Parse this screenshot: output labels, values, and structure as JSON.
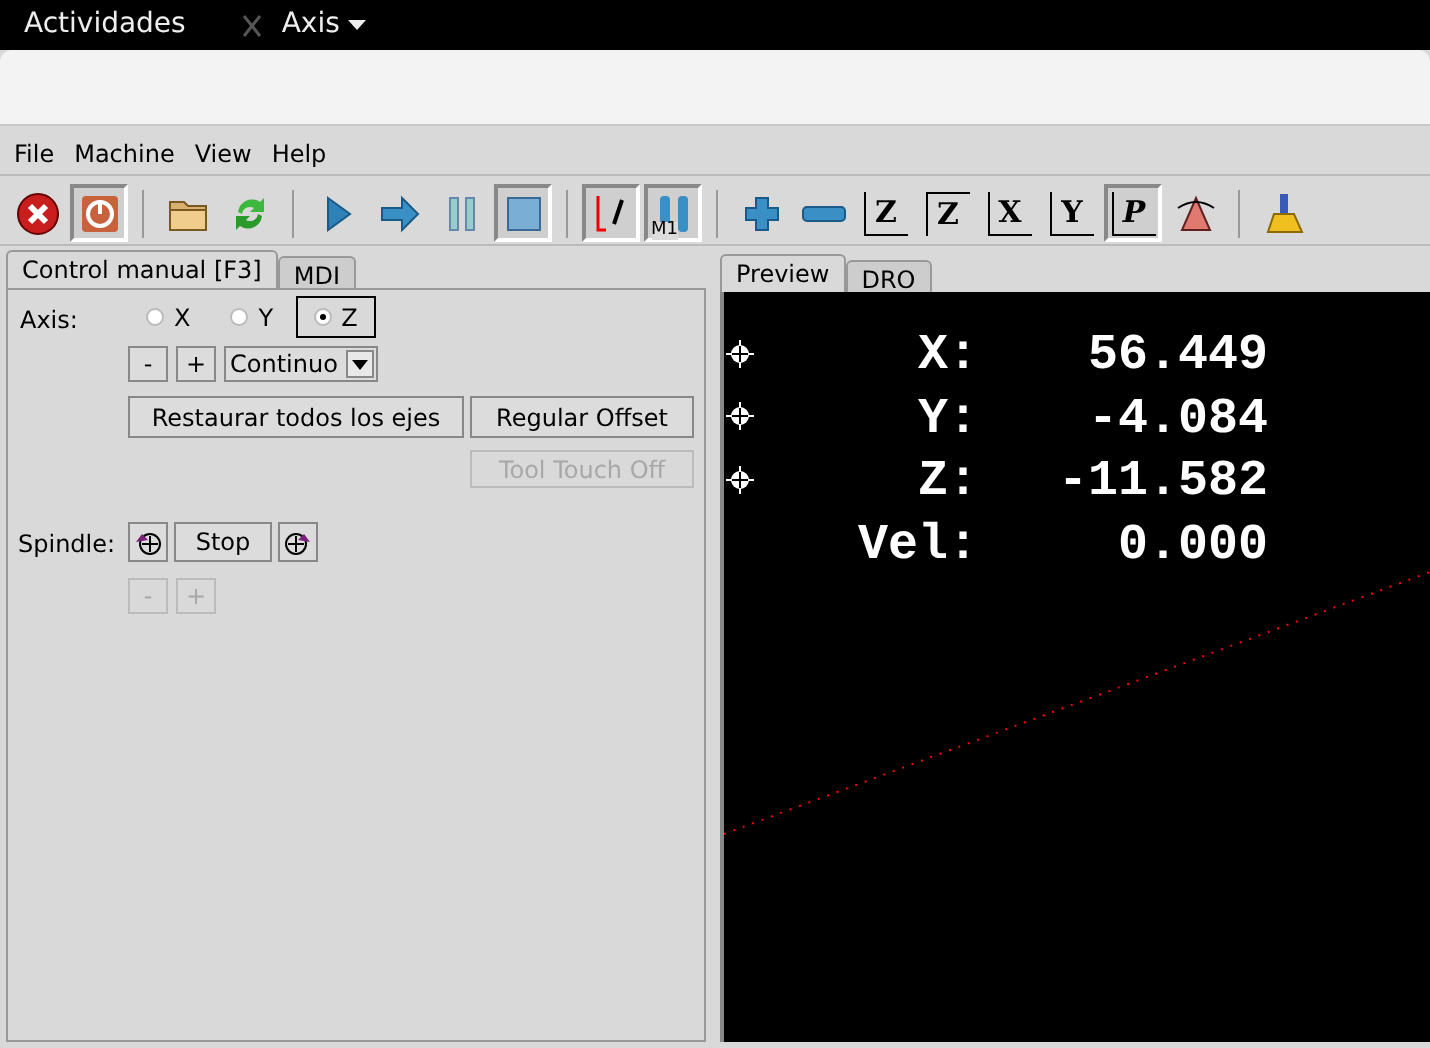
{
  "top_bar": {
    "activities": "Actividades",
    "app_menu": "Axis"
  },
  "menu": [
    "File",
    "Machine",
    "View",
    "Help"
  ],
  "toolbar": [
    {
      "kind": "estop",
      "pressed": false
    },
    {
      "kind": "power",
      "pressed": true
    },
    {
      "kind": "separator"
    },
    {
      "kind": "open",
      "pressed": false
    },
    {
      "kind": "reload",
      "pressed": false
    },
    {
      "kind": "separator"
    },
    {
      "kind": "run",
      "pressed": false
    },
    {
      "kind": "step",
      "pressed": false
    },
    {
      "kind": "pause",
      "pressed": false
    },
    {
      "kind": "stop",
      "pressed": true
    },
    {
      "kind": "separator"
    },
    {
      "kind": "blockdelete",
      "pressed": true
    },
    {
      "kind": "optstop",
      "label": "M1",
      "pressed": true
    },
    {
      "kind": "separator"
    },
    {
      "kind": "zoomin",
      "pressed": false
    },
    {
      "kind": "zoomout",
      "pressed": false
    },
    {
      "kind": "view",
      "label": "Z",
      "pressed": false
    },
    {
      "kind": "view2",
      "label": "Z",
      "pressed": false
    },
    {
      "kind": "view",
      "label": "X",
      "pressed": false
    },
    {
      "kind": "view",
      "label": "Y",
      "pressed": false
    },
    {
      "kind": "viewp",
      "label": "P",
      "pressed": true
    },
    {
      "kind": "rotate",
      "pressed": false
    },
    {
      "kind": "separator"
    },
    {
      "kind": "clear",
      "pressed": false
    }
  ],
  "left_tabs": [
    {
      "label": "Control manual [F3]",
      "selected": true
    },
    {
      "label": "MDI",
      "selected": false
    }
  ],
  "manual": {
    "axis_label": "Axis:",
    "axes": [
      {
        "label": "X",
        "selected": false
      },
      {
        "label": "Y",
        "selected": false
      },
      {
        "label": "Z",
        "selected": true
      }
    ],
    "jog_minus": "-",
    "jog_plus": "+",
    "jog_mode": "Continuo",
    "home_all": "Restaurar todos los ejes",
    "touch_off": "Regular Offset",
    "tool_touch_off": {
      "label": "Tool Touch Off",
      "disabled": true
    },
    "spindle_label": "Spindle:",
    "spindle_stop": "Stop",
    "spindle_minus": {
      "label": "-",
      "disabled": true
    },
    "spindle_plus": {
      "label": "+",
      "disabled": true
    }
  },
  "right_tabs": [
    {
      "label": "Preview",
      "selected": true
    },
    {
      "label": "DRO",
      "selected": false
    }
  ],
  "dro": [
    {
      "axis": "X:",
      "value": "56.449",
      "homed": true
    },
    {
      "axis": "Y:",
      "value": "-4.084",
      "homed": true
    },
    {
      "axis": "Z:",
      "value": "-11.582",
      "homed": true
    },
    {
      "axis": "Vel:",
      "value": "0.000",
      "homed": false
    }
  ]
}
